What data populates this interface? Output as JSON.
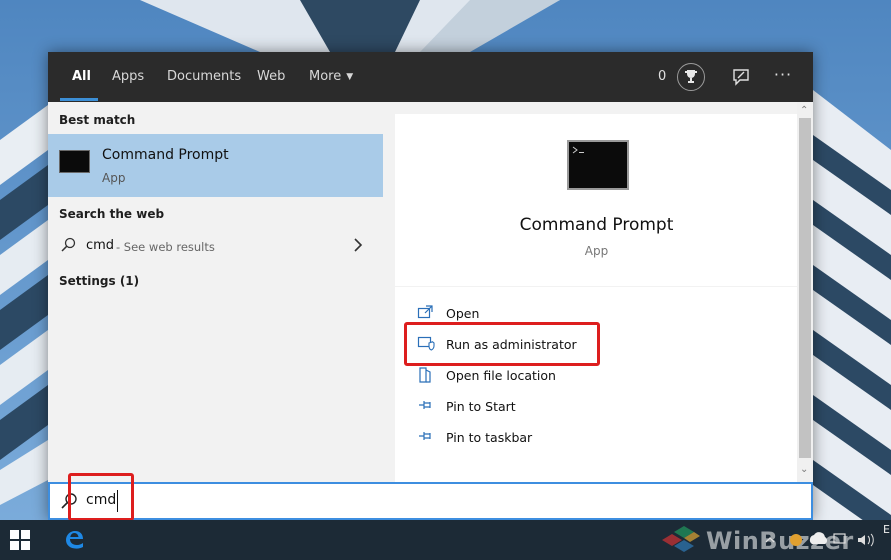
{
  "colors": {
    "accent": "#3d8ee0",
    "selected_row": "#a9cbe8",
    "highlight_red": "#dd1e1e",
    "topbar": "#2b2b2b",
    "taskbar": "#1c2a36"
  },
  "tabs": [
    {
      "label": "All",
      "active": true
    },
    {
      "label": "Apps"
    },
    {
      "label": "Documents"
    },
    {
      "label": "Web"
    },
    {
      "label": "More"
    }
  ],
  "topbar": {
    "points": "0",
    "icons": [
      "trophy-icon",
      "feedback-icon",
      "more-options-icon"
    ],
    "overflow_glyph": "···"
  },
  "left_pane": {
    "best_match_heading": "Best match",
    "best_match": {
      "title": "Command Prompt",
      "subtitle": "App",
      "icon": "command-prompt-icon"
    },
    "web_heading": "Search the web",
    "web_result": {
      "query": "cmd",
      "hint": "- See web results"
    },
    "settings_heading": "Settings (1)"
  },
  "preview": {
    "title": "Command Prompt",
    "subtitle": "App",
    "actions": [
      {
        "label": "Open",
        "icon": "open-icon"
      },
      {
        "label": "Run as administrator",
        "icon": "shield-icon"
      },
      {
        "label": "Open file location",
        "icon": "file-location-icon"
      },
      {
        "label": "Pin to Start",
        "icon": "pin-icon"
      },
      {
        "label": "Pin to taskbar",
        "icon": "pin-icon"
      }
    ]
  },
  "search_box": {
    "value": "cmd"
  },
  "taskbar": {
    "icons": [
      "windows-start-icon",
      "edge-icon"
    ],
    "tray_text": "E"
  },
  "watermark": "WinBuzzer"
}
